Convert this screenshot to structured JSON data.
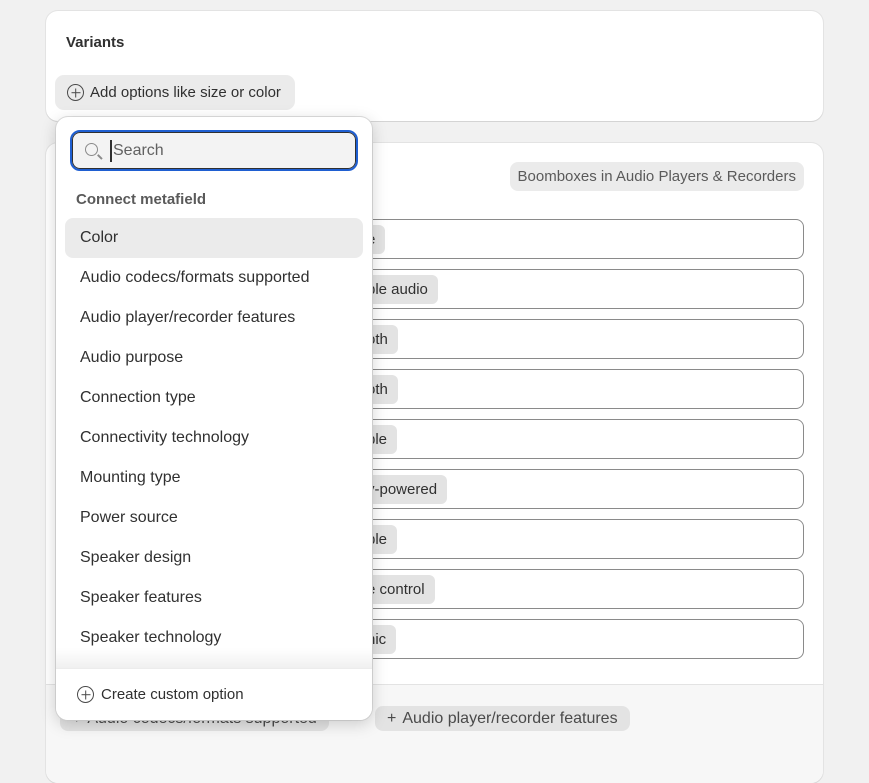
{
  "variants_card": {
    "title": "Variants",
    "add_button_label": "Add options like size or color"
  },
  "category_card": {
    "category_badge": "Boomboxes in Audio Players & Recorders",
    "rows": [
      {
        "chip": "e"
      },
      {
        "chip": "ble audio"
      },
      {
        "chip": "oth"
      },
      {
        "chip": "oth"
      },
      {
        "chip": "ble"
      },
      {
        "chip": "y-powered"
      },
      {
        "chip": "ble"
      },
      {
        "chip": "e control"
      },
      {
        "chip": "nic"
      }
    ],
    "footer_chips": [
      "Audio codecs/formats supported",
      "Audio player/recorder features"
    ]
  },
  "dropdown": {
    "search_placeholder": "Search",
    "search_value": "",
    "section_heading": "Connect metafield",
    "items": [
      "Color",
      "Audio codecs/formats supported",
      "Audio player/recorder features",
      "Audio purpose",
      "Connection type",
      "Connectivity technology",
      "Mounting type",
      "Power source",
      "Speaker design",
      "Speaker features",
      "Speaker technology"
    ],
    "selected_item": "Color",
    "create_label": "Create custom option"
  },
  "colors": {
    "focus_ring": "#1f5fd1",
    "page_bg": "#f1f1f1"
  }
}
